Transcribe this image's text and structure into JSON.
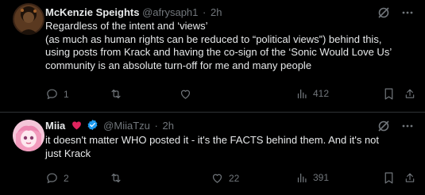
{
  "tweets": [
    {
      "author_name": "McKenzie Speights",
      "handle": "@afrysaph1",
      "separator": "·",
      "time": "2h",
      "lines": [
        "Regardless of the intent and ‘views’",
        "(as much as human rights can be reduced to “political views”)  behind this,",
        "using posts from Krack and having the co-sign of the ‘Sonic Would Love Us’",
        "community is an absolute turn-off for me and many people"
      ],
      "replies": "1",
      "retweets": "",
      "likes": "",
      "views": "412"
    },
    {
      "author_name": "Miia",
      "handle": "@MiiaTzu",
      "separator": "·",
      "time": "2h",
      "lines": [
        "it doesn't matter WHO posted it - it's the FACTS behind them. And it's not",
        "just Krack"
      ],
      "replies": "2",
      "retweets": "",
      "likes": "22",
      "views": "391"
    }
  ],
  "colors": {
    "background": "#000000",
    "text": "#e7e9ea",
    "muted": "#71767b",
    "verified": "#1d9bf0",
    "heart_emoji": "#e0245e",
    "divider": "#2f3336"
  }
}
